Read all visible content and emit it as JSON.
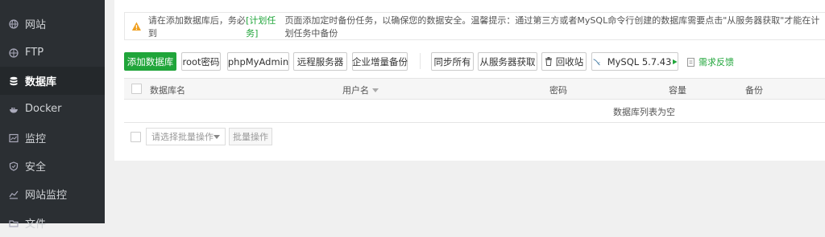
{
  "sidebar": {
    "items": [
      {
        "label": "网站",
        "icon": "globe-icon"
      },
      {
        "label": "FTP",
        "icon": "globe-icon"
      },
      {
        "label": "数据库",
        "icon": "database-icon",
        "active": true
      },
      {
        "label": "Docker",
        "icon": "docker-icon"
      },
      {
        "label": "监控",
        "icon": "monitor-icon"
      },
      {
        "label": "安全",
        "icon": "shield-icon"
      },
      {
        "label": "网站监控",
        "icon": "chart-icon"
      },
      {
        "label": "文件",
        "icon": "folder-icon"
      }
    ]
  },
  "alert": {
    "text_before": "请在添加数据库后，务必到",
    "link": "[计划任务]",
    "text_after": "页面添加定时备份任务，以确保您的数据安全。温馨提示：通过第三方或者MySQL命令行创建的数据库需要点击\"从服务器获取\"才能在计划任务中备份"
  },
  "toolbar": {
    "add_db": "添加数据库",
    "root_pwd": "root密码",
    "phpmyadmin": "phpMyAdmin",
    "remote": "远程服务器",
    "incremental": "企业增量备份",
    "sync_all": "同步所有",
    "get_from_server": "从服务器获取",
    "recycle": "回收站",
    "mysql_version": "MySQL 5.7.43",
    "feedback": "需求反馈"
  },
  "table": {
    "headers": {
      "name": "数据库名",
      "user": "用户名",
      "password": "密码",
      "capacity": "容量",
      "backup": "备份"
    },
    "empty_text": "数据库列表为空"
  },
  "batch": {
    "placeholder": "请选择批量操作",
    "button": "批量操作"
  },
  "colors": {
    "accent": "#20a53a",
    "sidebar": "#2b2f33",
    "warning": "#f0a020"
  }
}
